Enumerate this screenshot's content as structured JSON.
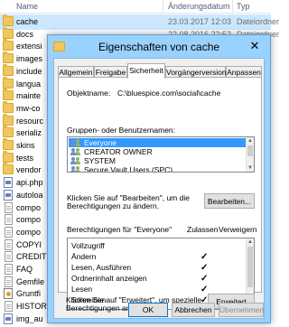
{
  "explorer": {
    "columns": {
      "name": "Name",
      "date": "Änderungsdatum",
      "type": "Typ"
    },
    "rows": [
      {
        "name": "cache",
        "date": "23.03.2017 12:03",
        "type": "Dateiordner",
        "icon": "folder-icon"
      },
      {
        "name": "docs",
        "date": "22.08.2016 22:52",
        "type": "Dateiordner",
        "icon": "folder-icon"
      },
      {
        "name": "extensi",
        "date": "",
        "type": "",
        "icon": "folder-icon"
      },
      {
        "name": "images",
        "date": "",
        "type": "",
        "icon": "folder-icon"
      },
      {
        "name": "include",
        "date": "",
        "type": "",
        "icon": "folder-icon"
      },
      {
        "name": "langua",
        "date": "",
        "type": "",
        "icon": "folder-icon"
      },
      {
        "name": "mainte",
        "date": "",
        "type": "",
        "icon": "folder-icon"
      },
      {
        "name": "mw-co",
        "date": "",
        "type": "",
        "icon": "folder-icon"
      },
      {
        "name": "resourc",
        "date": "",
        "type": "",
        "icon": "folder-icon"
      },
      {
        "name": "serializ",
        "date": "",
        "type": "",
        "icon": "folder-icon"
      },
      {
        "name": "skins",
        "date": "",
        "type": "",
        "icon": "folder-icon"
      },
      {
        "name": "tests",
        "date": "",
        "type": "",
        "icon": "folder-icon"
      },
      {
        "name": "vendor",
        "date": "",
        "type": "",
        "icon": "folder-icon"
      },
      {
        "name": "api.php",
        "date": "",
        "type": "",
        "icon": "php-file-icon"
      },
      {
        "name": "autoloa",
        "date": "",
        "type": "",
        "icon": "php-file-icon"
      },
      {
        "name": "compo",
        "date": "",
        "type": "",
        "icon": "file-icon"
      },
      {
        "name": "compo",
        "date": "",
        "type": "",
        "icon": "file-icon"
      },
      {
        "name": "compo",
        "date": "",
        "type": "",
        "icon": "file-icon"
      },
      {
        "name": "COPYI",
        "date": "",
        "type": "",
        "icon": "file-icon"
      },
      {
        "name": "CREDIT",
        "date": "",
        "type": "",
        "icon": "file-icon"
      },
      {
        "name": "FAQ",
        "date": "",
        "type": "",
        "icon": "file-icon"
      },
      {
        "name": "Gemfile",
        "date": "",
        "type": "",
        "icon": "file-icon"
      },
      {
        "name": "Gruntfi",
        "date": "",
        "type": "",
        "icon": "js-file-icon"
      },
      {
        "name": "HISTOR",
        "date": "",
        "type": "",
        "icon": "file-icon"
      },
      {
        "name": "img_au",
        "date": "",
        "type": "",
        "icon": "php-file-icon"
      }
    ]
  },
  "dialog": {
    "title": "Eigenschaften von cache",
    "close_glyph": "✕",
    "tabs": [
      {
        "label": "Allgemein",
        "active": false
      },
      {
        "label": "Freigabe",
        "active": false
      },
      {
        "label": "Sicherheit",
        "active": true
      },
      {
        "label": "Vorgängerversionen",
        "active": false
      },
      {
        "label": "Anpassen",
        "active": false
      }
    ],
    "object_label": "Objektname:",
    "object_value": "C:\\bluespice.com\\social\\cache",
    "groups_label": "Gruppen- oder Benutzernamen:",
    "groups": [
      {
        "name": "Everyone",
        "selected": true
      },
      {
        "name": "CREATOR OWNER",
        "selected": false
      },
      {
        "name": "SYSTEM",
        "selected": false
      },
      {
        "name": "Secure Vault Users (SPC)",
        "selected": false
      }
    ],
    "edit_text_line1": "Klicken Sie auf \"Bearbeiten\", um die",
    "edit_text_line2": "Berechtigungen zu ändern.",
    "edit_button": "Bearbeiten...",
    "perm_label": "Berechtigungen für \"Everyone\"",
    "allow_header": "Zulassen",
    "deny_header": "Verweigern",
    "permissions": [
      {
        "name": "Vollzugriff",
        "allow": false
      },
      {
        "name": "Ändern",
        "allow": true
      },
      {
        "name": "Lesen, Ausführen",
        "allow": true
      },
      {
        "name": "Ordnerinhalt anzeigen",
        "allow": true
      },
      {
        "name": "Lesen",
        "allow": true
      },
      {
        "name": "Schreiben",
        "allow": true
      }
    ],
    "check_glyph": "✓",
    "advanced_text_line1": "Klicken Sie auf \"Erweitert\", um spezielle",
    "advanced_text_line2": "Berechtigungen anzuzeigen.",
    "advanced_button": "Erweitert",
    "ok_button": "OK",
    "cancel_button": "Abbrechen",
    "apply_button": "Übernehmen"
  }
}
